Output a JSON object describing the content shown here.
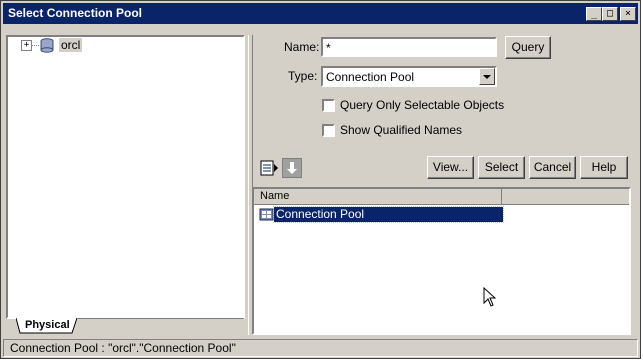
{
  "window": {
    "title": "Select Connection Pool"
  },
  "tree": {
    "root_label": "orcl",
    "expander": "+"
  },
  "tab": {
    "physical_label": "Physical"
  },
  "search": {
    "name_label": "Name:",
    "name_value": "*",
    "query_label": "Query",
    "type_label": "Type:",
    "type_value": "Connection Pool",
    "query_selectable_label": "Query Only Selectable Objects",
    "show_qualified_label": "Show Qualified Names"
  },
  "actions": {
    "view": "View...",
    "select": "Select",
    "cancel": "Cancel",
    "help": "Help"
  },
  "results": {
    "column_name": "Name",
    "rows": [
      {
        "label": "Connection Pool",
        "selected": true
      }
    ]
  },
  "status": {
    "text": "Connection Pool : \"orcl\".\"Connection Pool\""
  },
  "colors": {
    "title_bg": "#0a246a",
    "selection": "#0a246a",
    "face": "#d4d0c8"
  }
}
